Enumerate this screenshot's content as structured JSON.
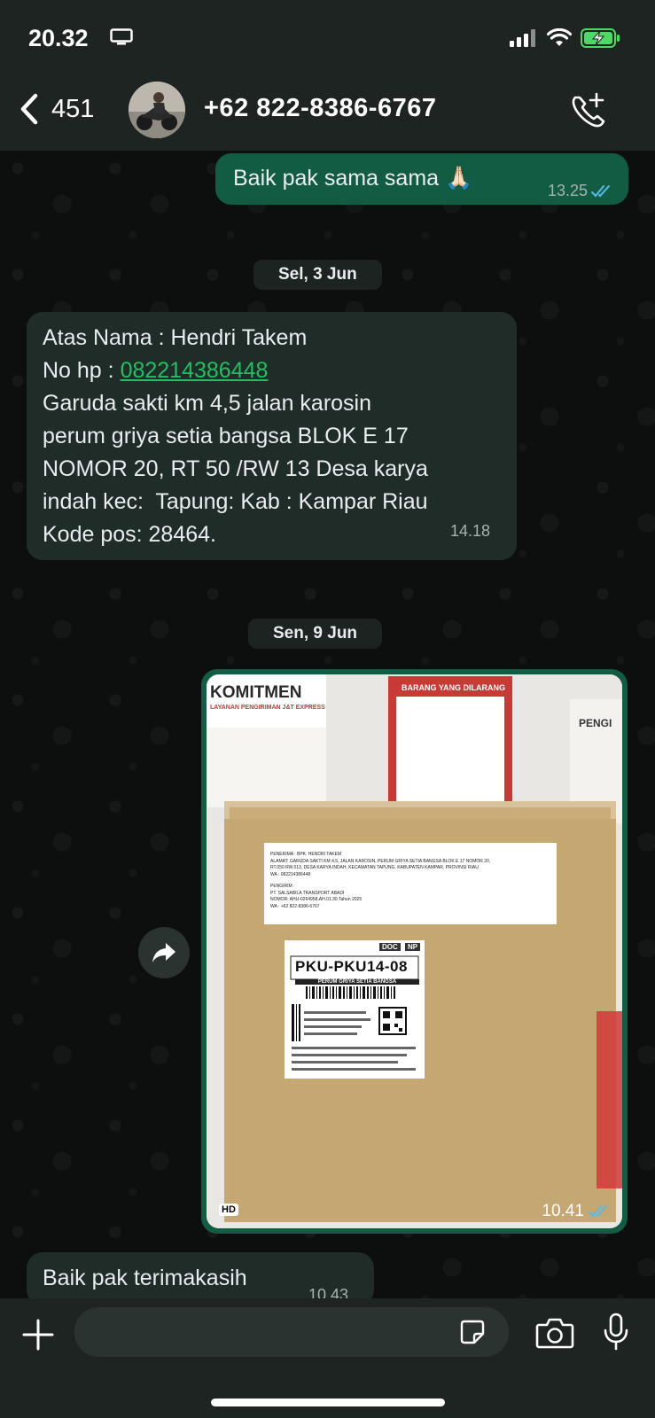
{
  "status_bar": {
    "time": "20.32"
  },
  "header": {
    "back_count": "451",
    "contact_name": "+62 822-8386-6767"
  },
  "messages": [
    {
      "direction": "outgoing",
      "text": "Baik pak sama sama 🙏🏻",
      "time": "13.25",
      "read": true
    },
    {
      "type": "date",
      "text": "Sel, 3 Jun"
    },
    {
      "direction": "incoming",
      "lines": [
        "Atas Nama : Hendri Takem",
        "No hp : ",
        "Garuda sakti km 4,5 jalan karosin",
        "perum griya setia bangsa BLOK E 17",
        "NOMOR 20, RT 50 /RW 13 Desa karya",
        "indah kec:  Tapung: Kab : Kampar Riau",
        "Kode pos: 28464."
      ],
      "phone_link": "082214386448",
      "time": "14.18"
    },
    {
      "type": "date",
      "text": "Sen, 9 Jun"
    },
    {
      "direction": "outgoing",
      "type": "image",
      "badge": "HD",
      "time": "10.41",
      "read": true,
      "photo_text": {
        "banner": "KOMITMEN",
        "banner_sub": "LAYANAN PENGIRIMAN J&T EXPRESS",
        "poster": "BARANG YANG DILARANG",
        "right_poster": "PENGI",
        "recipient": "PENERIMA : BPK. HENDRI TAKEM",
        "address1": "ALAMAT: GARUDA SAKTI KM 4,5, JALAN KAROSIN, PERUM GRIYA SETIA BANGSA BLOK E 17 NOMOR 20,",
        "address2": "RT.050 RW.013, DESA KARYA INDAH, KECAMATAN TAPUNG, KABUPATEN KAMPAR, PROVINSI RIAU",
        "wa": "WA : 082214386448",
        "sender_label": "PENGIRIM :",
        "sender": "PT. SALSABILA TRANSPORT ABADI",
        "sender_nomor": "NOMOR: AHU-0264958.AH.01.30.Tahun 2025",
        "sender_wa": "WA : +62 822-8386-6767",
        "label_doc": "DOC",
        "label_np": "NP",
        "label_code": "PKU-PKU14-08",
        "label_sub": "PERUM GRIYA SETIA BANGSA"
      }
    },
    {
      "direction": "incoming",
      "text": "Baik pak terimakasih",
      "time": "10.43"
    }
  ],
  "composer": {
    "placeholder": ""
  },
  "colors": {
    "outgoing_bubble": "#125c43",
    "incoming_bubble": "#202c28",
    "link": "#21c063",
    "read_ticks": "#53bdeb",
    "bar_background": "#1d2421"
  },
  "icons": [
    "monitor-icon",
    "signal-icon",
    "wifi-icon",
    "battery-charging-icon",
    "chevron-left-icon",
    "add-call-icon",
    "forward-icon",
    "plus-icon",
    "sticker-icon",
    "camera-icon",
    "mic-icon",
    "double-check-icon"
  ]
}
